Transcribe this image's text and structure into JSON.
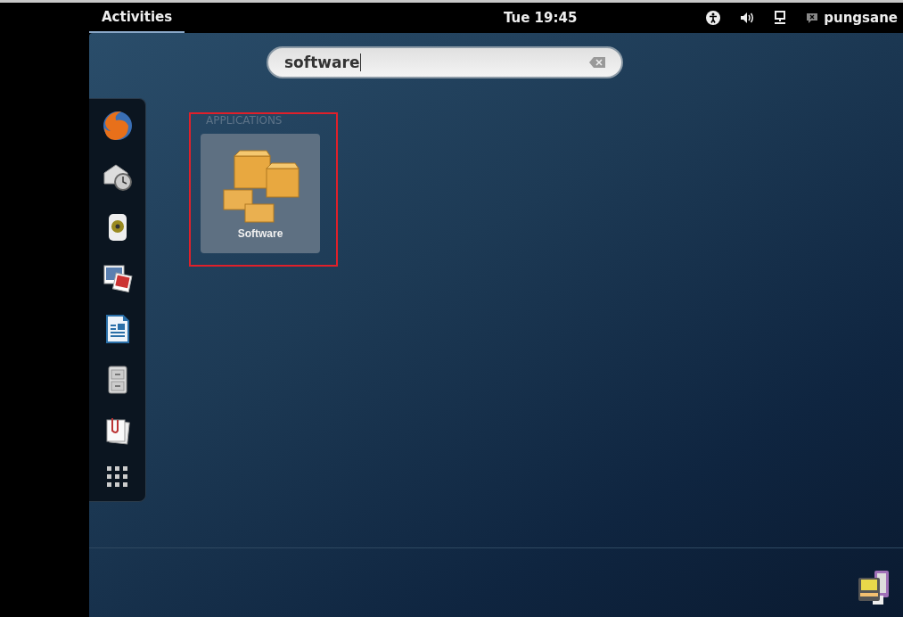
{
  "top_bar": {
    "activities": {
      "label": "Activities",
      "selected": true
    },
    "clock": "Tue 19:45",
    "user": "pungsane"
  },
  "search": {
    "value": "software"
  },
  "results": {
    "highlighted": true,
    "section_title": "APPLICATIONS",
    "items": [
      {
        "label": "Software",
        "selected": true
      }
    ]
  }
}
